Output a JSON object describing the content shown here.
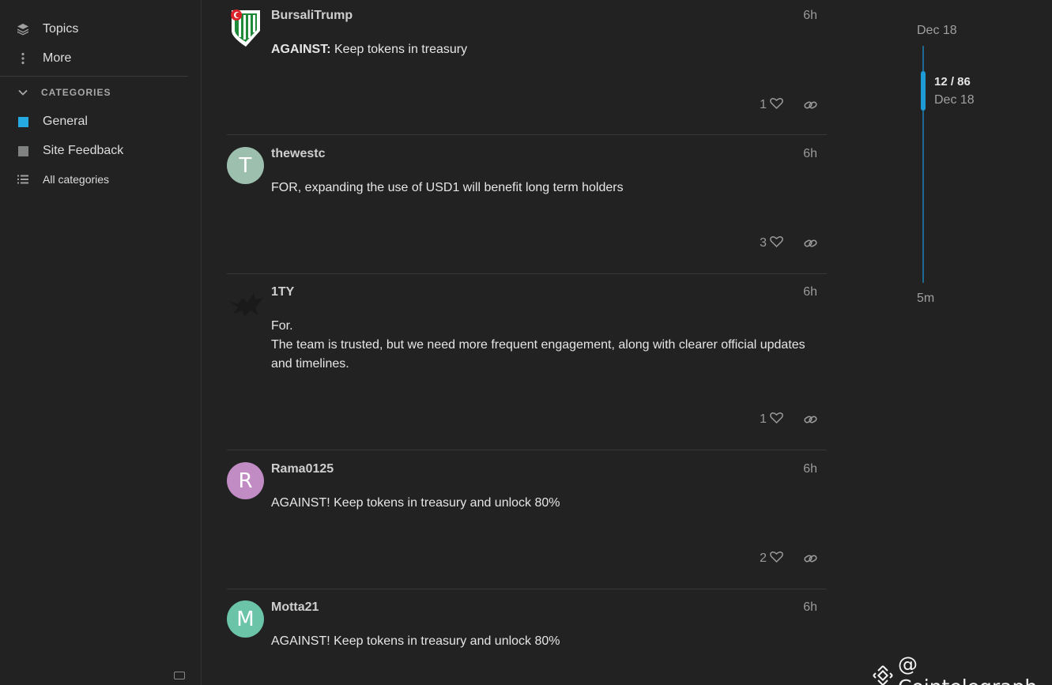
{
  "sidebar": {
    "topics_label": "Topics",
    "more_label": "More",
    "categories_header": "CATEGORIES",
    "categories": [
      {
        "label": "General",
        "color": "#25aae2"
      },
      {
        "label": "Site Feedback",
        "color": "#808281"
      }
    ],
    "all_categories_label": "All categories"
  },
  "posts": [
    {
      "username": "BursaliTrump",
      "time": "6h",
      "body_bold": "AGAINST:",
      "body": " Keep tokens in treasury",
      "likes": "1",
      "avatar_icon": "team-crest-icon"
    },
    {
      "username": "thewestc",
      "time": "6h",
      "body": "FOR, expanding the use of USD1 will benefit long term holders",
      "likes": "3",
      "avatar_letter": "T",
      "avatar_color": "#9dbfae"
    },
    {
      "username": "1TY",
      "time": "6h",
      "body_line1": "For.",
      "body_line2": "The team is trusted, but we need more frequent engagement, along with clearer official updates and timelines.",
      "likes": "1",
      "avatar_icon": "bird-icon"
    },
    {
      "username": "Rama0125",
      "time": "6h",
      "body": "AGAINST! Keep tokens in treasury and unlock 80%",
      "likes": "2",
      "avatar_letter": "R",
      "avatar_color": "#c08cc3"
    },
    {
      "username": "Motta21",
      "time": "6h",
      "body": "AGAINST! Keep tokens in treasury and unlock 80%",
      "avatar_letter": "M",
      "avatar_color": "#6bc3a8"
    }
  ],
  "timeline": {
    "top_date": "Dec 18",
    "position": "12 / 86",
    "current_date": "Dec 18",
    "bottom_label": "5m"
  },
  "watermark": {
    "text": "@ Cointelegraph"
  }
}
